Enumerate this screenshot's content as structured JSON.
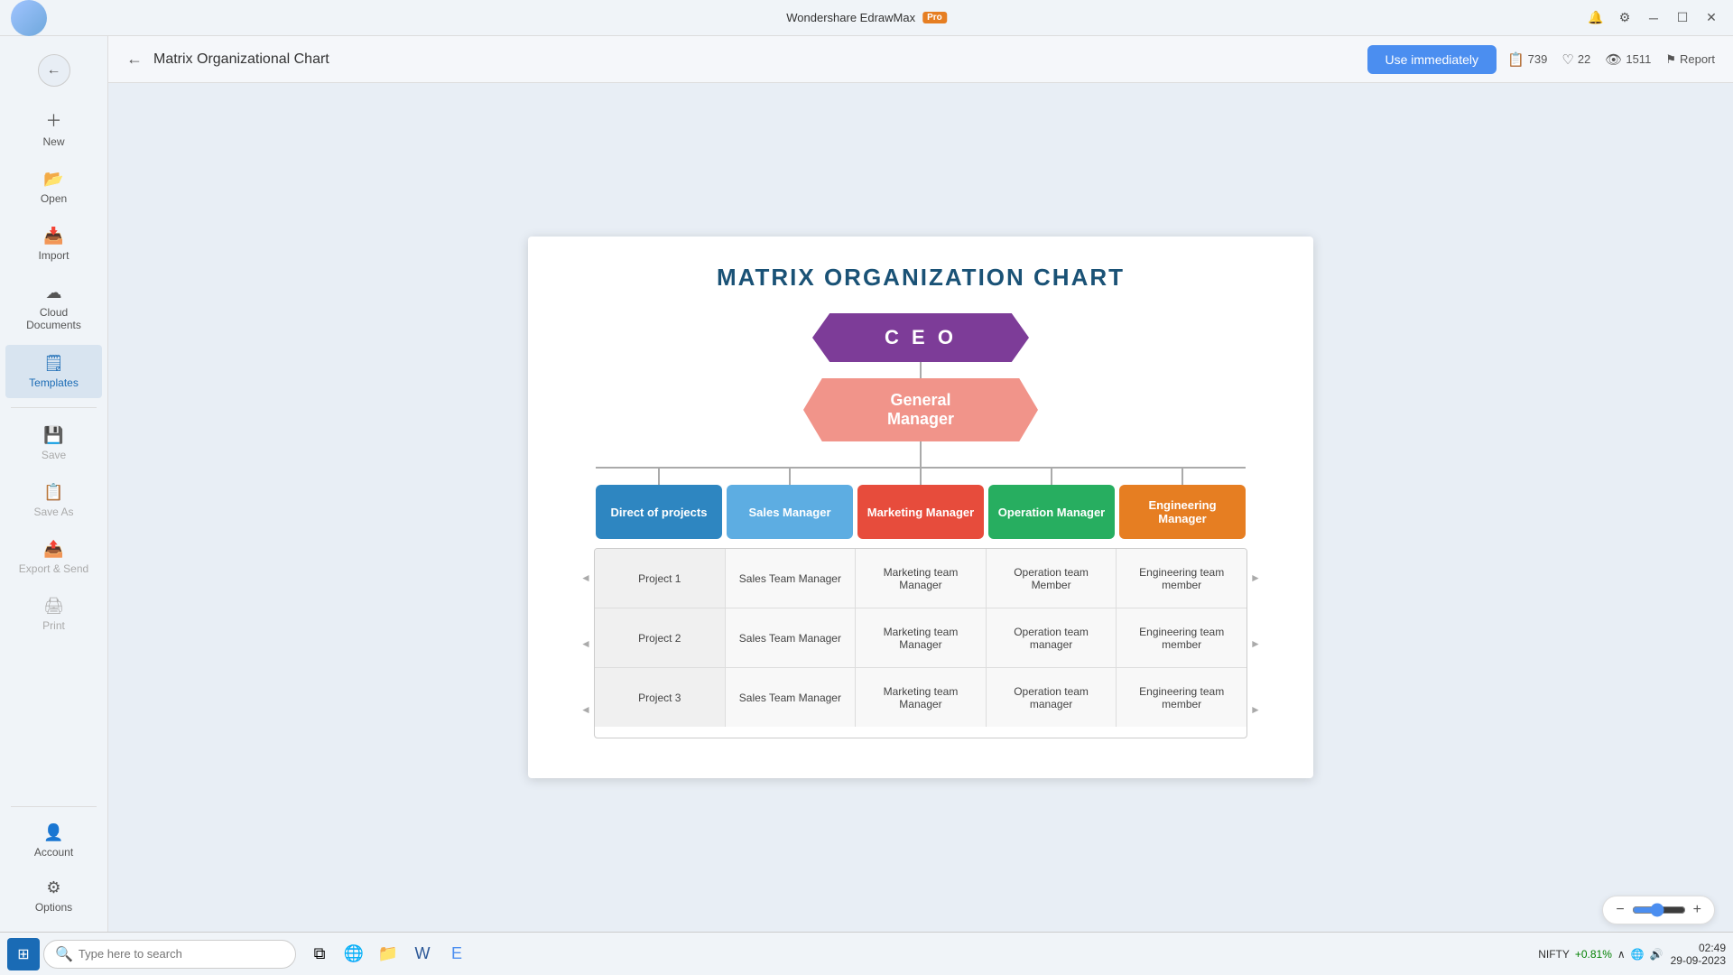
{
  "app": {
    "title": "Wondershare EdrawMax",
    "pro_label": "Pro"
  },
  "header": {
    "back_label": "←",
    "page_title": "Matrix Organizational Chart",
    "use_btn_label": "Use immediately",
    "stats": {
      "copies": "739",
      "likes": "22",
      "views": "1511",
      "report": "Report"
    }
  },
  "sidebar": {
    "new_label": "New",
    "open_label": "Open",
    "import_label": "Import",
    "cloud_label": "Cloud Documents",
    "templates_label": "Templates",
    "save_label": "Save",
    "save_as_label": "Save As",
    "export_label": "Export & Send",
    "print_label": "Print",
    "account_label": "Account",
    "options_label": "Options"
  },
  "chart": {
    "title": "MATRIX ORGANIZATION CHART",
    "ceo_label": "C E O",
    "gm_label": "General Manager",
    "managers": [
      {
        "label": "Direct of projects",
        "color": "mgr-blue"
      },
      {
        "label": "Sales Manager",
        "color": "mgr-cyan"
      },
      {
        "label": "Marketing Manager",
        "color": "mgr-red"
      },
      {
        "label": "Operation Manager",
        "color": "mgr-green"
      },
      {
        "label": "Engineering Manager",
        "color": "mgr-orange"
      }
    ],
    "rows": [
      {
        "project": "Project 1",
        "cells": [
          "Sales Team Manager",
          "Marketing team Manager",
          "Operation team Member",
          "Engineering team member"
        ]
      },
      {
        "project": "Project 2",
        "cells": [
          "Sales Team Manager",
          "Marketing team Manager",
          "Operation team manager",
          "Engineering team member"
        ]
      },
      {
        "project": "Project 3",
        "cells": [
          "Sales Team Manager",
          "Marketing team Manager",
          "Operation team manager",
          "Engineering team member"
        ]
      }
    ]
  },
  "zoom": {
    "level": "—",
    "minus": "−",
    "plus": "+"
  },
  "taskbar": {
    "search_placeholder": "Type here to search",
    "time": "02:49",
    "date": "29-09-2023",
    "nifty_label": "NIFTY",
    "nifty_change": "+0.81%"
  }
}
